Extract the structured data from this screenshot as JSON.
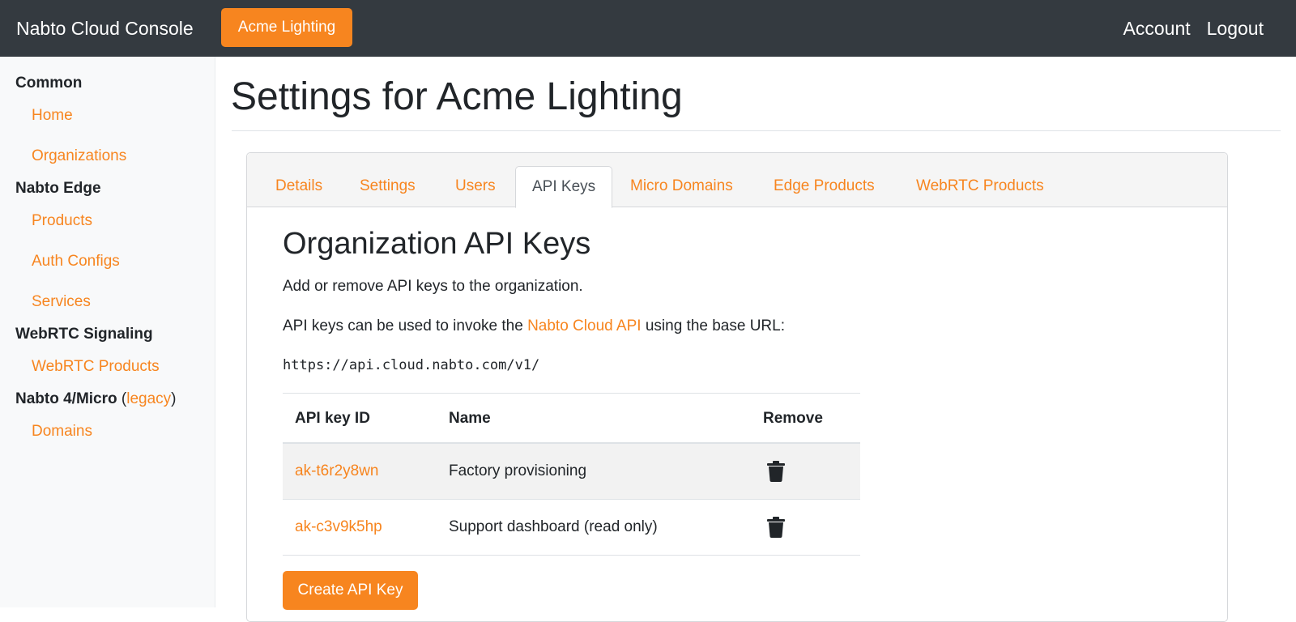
{
  "navbar": {
    "brand": "Nabto Cloud Console",
    "org_button": "Acme Lighting",
    "account": "Account",
    "logout": "Logout"
  },
  "sidebar": {
    "sections": [
      {
        "title": "Common",
        "items": [
          "Home",
          "Organizations"
        ]
      },
      {
        "title": "Nabto Edge",
        "items": [
          "Products",
          "Auth Configs",
          "Services"
        ]
      },
      {
        "title": "WebRTC Signaling",
        "items": [
          "WebRTC Products"
        ]
      },
      {
        "title": "Nabto 4/Micro",
        "legacy_open": "(",
        "legacy_link": "legacy",
        "legacy_close": ")",
        "items": [
          "Domains"
        ]
      }
    ]
  },
  "main": {
    "page_title": "Settings for Acme Lighting",
    "tabs": [
      {
        "label": "Details",
        "active": false
      },
      {
        "label": "Settings",
        "active": false
      },
      {
        "label": "Users",
        "active": false
      },
      {
        "label": "API Keys",
        "active": true
      },
      {
        "label": "Micro Domains",
        "active": false
      },
      {
        "label": "Edge Products",
        "active": false
      },
      {
        "label": "WebRTC Products",
        "active": false
      }
    ],
    "section_title": "Organization API Keys",
    "intro": "Add or remove API keys to the organization.",
    "usage_prefix": "API keys can be used to invoke the ",
    "usage_link": "Nabto Cloud API",
    "usage_suffix": " using the base URL:",
    "base_url": "https://api.cloud.nabto.com/v1/",
    "table": {
      "headers": [
        "API key ID",
        "Name",
        "Remove"
      ],
      "rows": [
        {
          "id": "ak-t6r2y8wn",
          "name": "Factory provisioning",
          "remove_icon": "trash-icon"
        },
        {
          "id": "ak-c3v9k5hp",
          "name": "Support dashboard (read only)",
          "remove_icon": "trash-icon"
        }
      ]
    },
    "create_button": "Create API Key"
  },
  "colors": {
    "accent": "#f7851f",
    "navbar_bg": "#343a40",
    "sidebar_bg": "#f8f9fa"
  }
}
